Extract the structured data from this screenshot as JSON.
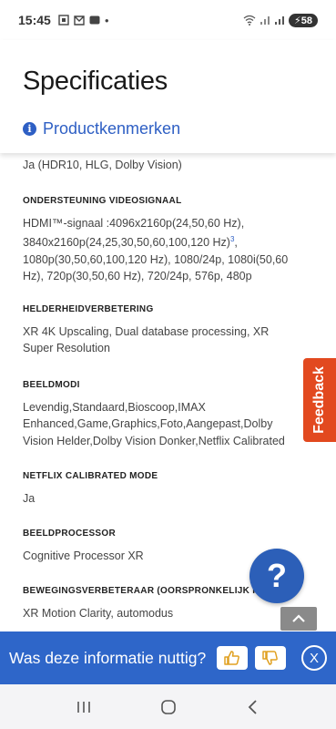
{
  "status_bar": {
    "time": "15:45",
    "left_icons": [
      "screenshot-icon",
      "mail-icon",
      "app-icon",
      "dot-icon"
    ],
    "battery": "58"
  },
  "header": {
    "title": "Specificaties",
    "product_link": "Productkenmerken"
  },
  "specs": {
    "first_value": "Ja (HDR10, HLG, Dolby Vision)",
    "items": [
      {
        "label": "ONDERSTEUNING VIDEOSIGNAAL",
        "value": "HDMI™-signaal :4096x2160p(24,50,60 Hz), 3840x2160p(24,25,30,50,60,100,120 Hz)",
        "footnote": "3",
        "value_rest": ", 1080p(30,50,60,100,120 Hz), 1080/24p, 1080i(50,60 Hz), 720p(30,50,60 Hz), 720/24p, 576p, 480p"
      },
      {
        "label": "HELDERHEIDVERBETERING",
        "value": "XR 4K Upscaling, Dual database processing, XR Super Resolution"
      },
      {
        "label": "BEELDMODI",
        "value": "Levendig,Standaard,Bioscoop,IMAX Enhanced,Game,Graphics,Foto,Aangepast,Dolby Vision Helder,Dolby Vision Donker,Netflix Calibrated"
      },
      {
        "label": "NETFLIX CALIBRATED MODE",
        "value": "Ja"
      },
      {
        "label": "BEELDPROCESSOR",
        "value": "Cognitive Processor XR"
      },
      {
        "label": "BEWEGINGSVERBETERAAR (OORSPRONKELIJK HZ)",
        "value": "XR Motion Clarity, automodus"
      }
    ]
  },
  "feedback_tab": "Feedback",
  "help_button": "?",
  "feedback_bar": {
    "question": "Was deze informatie nuttig?",
    "close": "X"
  },
  "colors": {
    "accent_blue": "#2e66c9",
    "feedback_orange": "#e2491f",
    "help_blue": "#2c5fb8"
  }
}
